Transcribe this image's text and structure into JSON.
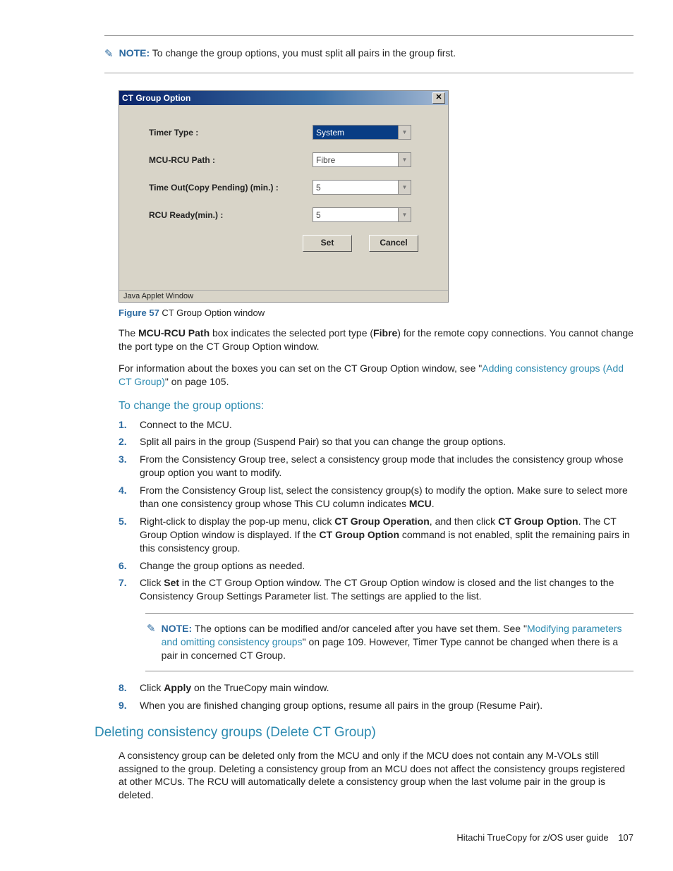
{
  "note_top": {
    "label": "NOTE:",
    "text": "To change the group options, you must split all pairs in the group first."
  },
  "dialog": {
    "title": "CT Group Option",
    "close": "✕",
    "rows": {
      "timer_label": "Timer Type :",
      "timer_value": "System",
      "path_label": "MCU-RCU Path :",
      "path_value": "Fibre",
      "timeout_label": "Time Out(Copy Pending) (min.) :",
      "timeout_value": "5",
      "rcu_label": "RCU Ready(min.) :",
      "rcu_value": "5"
    },
    "set_btn": "Set",
    "cancel_btn": "Cancel",
    "statusbar": "Java Applet Window"
  },
  "figure": {
    "label": "Figure 57",
    "text": " CT Group Option window"
  },
  "para1_a": "The ",
  "para1_b": "MCU-RCU Path",
  "para1_c": " box indicates the selected port type (",
  "para1_d": "Fibre",
  "para1_e": ") for the remote copy connections. You cannot change the port type on the CT Group Option window.",
  "para2_a": "For information about the boxes you can set on the CT Group Option window, see \"",
  "para2_link": "Adding consistency groups (Add CT Group)",
  "para2_b": "\" on page 105.",
  "subhead": "To change the group options:",
  "steps": {
    "s1": "Connect to the MCU.",
    "s2": "Split all pairs in the group (Suspend Pair) so that you can change the group options.",
    "s3": "From the Consistency Group tree, select a consistency group mode that includes the consistency group whose group option you want to modify.",
    "s4_a": "From the Consistency Group list, select the consistency group(s) to modify the option. Make sure to select more than one consistency group whose This CU column indicates ",
    "s4_b": "MCU",
    "s4_c": ".",
    "s5_a": "Right-click to display the pop-up menu, click ",
    "s5_b": "CT Group Operation",
    "s5_c": ", and then click ",
    "s5_d": "CT Group Option",
    "s5_e": ". The CT Group Option window is displayed. If the ",
    "s5_f": "CT Group Option",
    "s5_g": " command is not enabled, split the remaining pairs in this consistency group.",
    "s6": "Change the group options as needed.",
    "s7_a": "Click ",
    "s7_b": "Set",
    "s7_c": " in the CT Group Option window. The CT Group Option window is closed and the list changes to the Consistency Group Settings Parameter list. The settings are applied to the list.",
    "note2_label": "NOTE:",
    "note2_a": "The options can be modified and/or canceled after you have set them. See \"",
    "note2_link": "Modifying parameters and omitting consistency groups",
    "note2_b": "\" on page 109. However, Timer Type cannot be changed when there is a pair in concerned CT Group.",
    "s8_a": "Click ",
    "s8_b": "Apply",
    "s8_c": " on the TrueCopy main window.",
    "s9": "When you are finished changing group options, resume all pairs in the group (Resume Pair)."
  },
  "section_head": "Deleting consistency groups (Delete CT Group)",
  "section_para": "A consistency group can be deleted only from the MCU and only if the MCU does not contain any M-VOLs still assigned to the group. Deleting a consistency group from an MCU does not affect the consistency groups registered at other MCUs. The RCU will automatically delete a consistency group when the last volume pair in the group is deleted.",
  "footer": {
    "doc": "Hitachi TrueCopy for z/OS user guide",
    "page": "107"
  }
}
